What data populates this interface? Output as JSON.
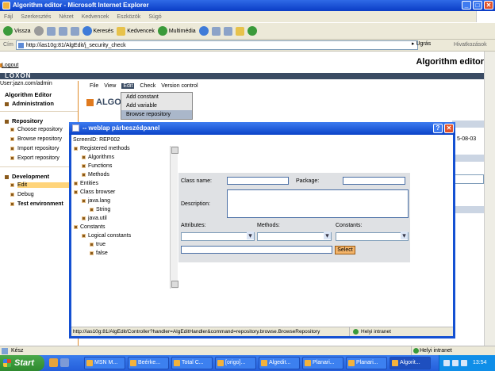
{
  "window": {
    "title": "Algorithm editor - Microsoft Internet Explorer",
    "btn_min": "_",
    "btn_max": "□",
    "btn_close": "✕"
  },
  "ie_menu": [
    "Fájl",
    "Szerkesztés",
    "Nézet",
    "Kedvencek",
    "Eszközök",
    "Súgó"
  ],
  "toolbar": {
    "back": "Vissza",
    "search": "Keresés",
    "favorites": "Kedvencek",
    "media": "Multimédia"
  },
  "address": {
    "label": "Cím",
    "url": "http://ias10g:81/AlgEdit/j_security_check",
    "go": "Ugrás",
    "links": "Hivatkozások"
  },
  "page": {
    "logout": "Logout",
    "title": "Algorithm editor",
    "brand": "LOXON",
    "user": "User:jazn.com/admin",
    "date_fragment": "5-08-03"
  },
  "sidebar": {
    "algorithm_editor": "Algorithm Editor",
    "administration": "Administration",
    "repository": "Repository",
    "repository_items": [
      "Choose repository",
      "Browse repository",
      "Import repository",
      "Export repository"
    ],
    "development": "Development",
    "development_items": [
      "Edit",
      "Debug",
      "Test environment"
    ]
  },
  "app_menu": [
    "File",
    "View",
    "Edit",
    "Check",
    "Version control"
  ],
  "edit_dropdown": [
    "Add constant",
    "Add variable",
    "Browse repository"
  ],
  "logo_text": "ALGORI",
  "dialog": {
    "title": "-- weblap párbeszédpanel",
    "help": "?",
    "close": "✕",
    "screen_id": "ScreenID: REP002",
    "tree": [
      {
        "label": "Registered methods",
        "level": 0
      },
      {
        "label": "Algorithms",
        "level": 1
      },
      {
        "label": "Functions",
        "level": 1
      },
      {
        "label": "Methods",
        "level": 1
      },
      {
        "label": "Entities",
        "level": 0
      },
      {
        "label": "Class browser",
        "level": 0
      },
      {
        "label": "java.lang",
        "level": 1
      },
      {
        "label": "String",
        "level": 2
      },
      {
        "label": "java.util",
        "level": 1
      },
      {
        "label": "Constants",
        "level": 0
      },
      {
        "label": "Logical constants",
        "level": 1
      },
      {
        "label": "true",
        "level": 2
      },
      {
        "label": "false",
        "level": 2
      }
    ],
    "class_name_label": "Class name:",
    "package_label": "Package:",
    "description_label": "Description:",
    "attributes_label": "Attributes:",
    "methods_label": "Methods:",
    "constants_label": "Constants:",
    "select_button": "Select",
    "status_url": "http://ias10g:81/AlgEdit/Controller?handler=AlgEditHandler&command=repository.browse.BrowseRepository",
    "status_zone": "Helyi intranet"
  },
  "statusbar": {
    "text": "Kész",
    "zone": "Helyi intranet"
  },
  "taskbar": {
    "start": "Start",
    "tasks": [
      "MSN M...",
      "Beérke...",
      "Total C...",
      "[origo]...",
      "Algedit...",
      "Planari...",
      "Planari...",
      "Algorit..."
    ],
    "clock": "13:54"
  }
}
